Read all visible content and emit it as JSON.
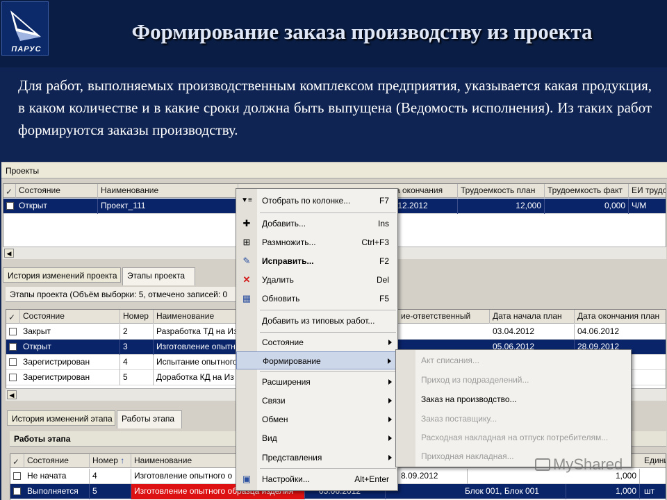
{
  "slide": {
    "logo_text": "ПАРУС",
    "title": "Формирование заказа производству из проекта",
    "intro": "Для работ, выполняемых производственным комплексом предприятия, указывается какая продукция, в каком количестве и в какие сроки должна быть выпущена (Ведомость исполнения). Из таких работ формируются заказы производству."
  },
  "projects": {
    "panel_title": "Проекты",
    "columns": [
      "Состояние",
      "Наименование",
      "",
      "",
      "а окончания",
      "Трудоемкость план",
      "Трудоемкость факт",
      "ЕИ трудо"
    ],
    "rows": [
      {
        "state": "Открыт",
        "name": "Проект_111",
        "end": ".12.2012",
        "labor_plan": "12,000",
        "labor_fact": "0,000",
        "unit": "Ч/М"
      }
    ]
  },
  "stage_tabs": [
    "История изменений проекта",
    "Этапы проекта"
  ],
  "stages": {
    "panel_title": "Этапы проекта (Объём выборки: 5, отмечено записей: 0",
    "columns": [
      "Состояние",
      "Номер",
      "Наименование",
      "ие-ответственный",
      "Дата начала план",
      "Дата окончания план"
    ],
    "rows": [
      {
        "state": "Закрыт",
        "number": "2",
        "name": "Разработка ТД на Из",
        "start": "03.04.2012",
        "end": "04.06.2012"
      },
      {
        "state": "Открыт",
        "number": "3",
        "name": "Изготовление опытн",
        "start": "05.06.2012",
        "end": "28.09.2012"
      },
      {
        "state": "Зарегистрирован",
        "number": "4",
        "name": "Испытание опытного",
        "start": "",
        "end": ""
      },
      {
        "state": "Зарегистрирован",
        "number": "5",
        "name": "Доработка КД на Из",
        "start": "",
        "end": ""
      }
    ]
  },
  "work_tabs": [
    "История изменений этапа",
    "Работы этапа"
  ],
  "works": {
    "panel_title": "Работы этапа",
    "columns": [
      "Состояние",
      "Номер",
      "Наименование",
      "Едини"
    ],
    "sort_arrow": "↑",
    "rows": [
      {
        "state": "Не начата",
        "number": "4",
        "name": "Изготовление опытного о",
        "date": "8.09.2012",
        "blocks": "",
        "qty": "1,000",
        "unit": ""
      },
      {
        "state": "Выполняется",
        "number": "5",
        "name": "Изготовление опытного образца изделия",
        "date": "05.06.2012",
        "blocks": "Блок 001, Блок 001",
        "qty": "1,000",
        "unit": "шт"
      }
    ]
  },
  "context_menu": {
    "items": [
      {
        "icon": "filter-icon",
        "glyph": "▼≡",
        "label": "Отобрать по колонке...",
        "shortcut": "F7"
      },
      {
        "icon": "add-icon",
        "glyph": "✚",
        "label": "Добавить...",
        "shortcut": "Ins"
      },
      {
        "icon": "duplicate-icon",
        "glyph": "⊞",
        "label": "Размножить...",
        "shortcut": "Ctrl+F3"
      },
      {
        "icon": "edit-icon",
        "glyph": "✎",
        "label": "Исправить...",
        "shortcut": "F2"
      },
      {
        "icon": "delete-icon",
        "glyph": "✕",
        "label": "Удалить",
        "shortcut": "Del"
      },
      {
        "icon": "refresh-icon",
        "glyph": "▦",
        "label": "Обновить",
        "shortcut": "F5"
      },
      {
        "label": "Добавить из типовых работ..."
      },
      {
        "label": "Состояние"
      },
      {
        "label": "Формирование"
      },
      {
        "label": "Расширения"
      },
      {
        "label": "Связи"
      },
      {
        "label": "Обмен"
      },
      {
        "label": "Вид"
      },
      {
        "label": "Представления"
      },
      {
        "icon": "settings-icon",
        "glyph": "▣",
        "label": "Настройки...",
        "shortcut": "Alt+Enter"
      }
    ]
  },
  "submenu": {
    "items": [
      {
        "label": "Акт списания...",
        "enabled": false
      },
      {
        "label": "Приход из подразделений...",
        "enabled": false
      },
      {
        "label": "Заказ на производство...",
        "enabled": true
      },
      {
        "label": "Заказ поставщику...",
        "enabled": false
      },
      {
        "label": "Расходная накладная на отпуск потребителям...",
        "enabled": false
      },
      {
        "label": "Приходная накладная...",
        "enabled": false
      }
    ]
  },
  "watermark": "MyShared"
}
